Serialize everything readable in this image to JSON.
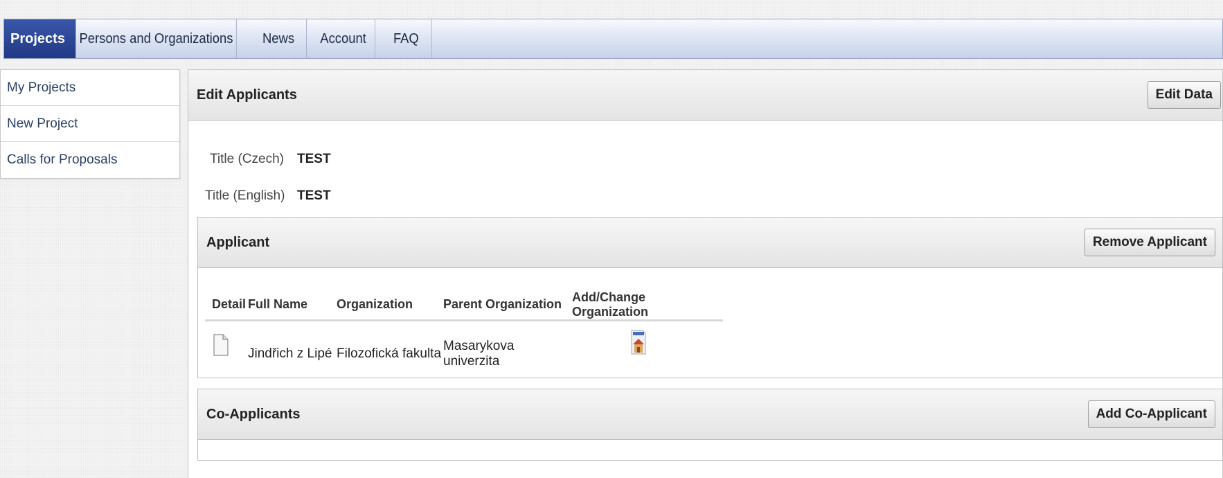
{
  "nav": {
    "tabs": [
      {
        "label": "Projects",
        "active": true
      },
      {
        "label": "Persons and Organizations",
        "active": false
      },
      {
        "label": "News",
        "active": false
      },
      {
        "label": "Account",
        "active": false
      },
      {
        "label": "FAQ",
        "active": false
      }
    ]
  },
  "sidebar": {
    "items": [
      {
        "label": "My Projects"
      },
      {
        "label": "New Project"
      },
      {
        "label": "Calls for Proposals"
      }
    ]
  },
  "main": {
    "title": "Edit Applicants",
    "edit_button": "Edit Data",
    "fields": [
      {
        "label": "Title (Czech)",
        "value": "TEST"
      },
      {
        "label": "Title (English)",
        "value": "TEST"
      }
    ]
  },
  "applicant": {
    "title": "Applicant",
    "remove_button": "Remove Applicant",
    "columns": [
      "Detail",
      "Full Name",
      "Organization",
      "Parent Organization",
      "Add/Change Organization"
    ],
    "rows": [
      {
        "detail_icon": "document-icon",
        "full_name": "Jindřich z Lipé",
        "organization": "Filozofická fakulta",
        "parent_organization": "Masarykova univerzita",
        "change_icon": "organization-icon"
      }
    ]
  },
  "co_applicants": {
    "title": "Co-Applicants",
    "add_button": "Add Co-Applicant"
  },
  "colors": {
    "active_tab": "#213a86",
    "nav_gradient_top": "#f7f9fd",
    "nav_gradient_bottom": "#c7d2ea",
    "sidebar_link": "#2a3f67"
  }
}
